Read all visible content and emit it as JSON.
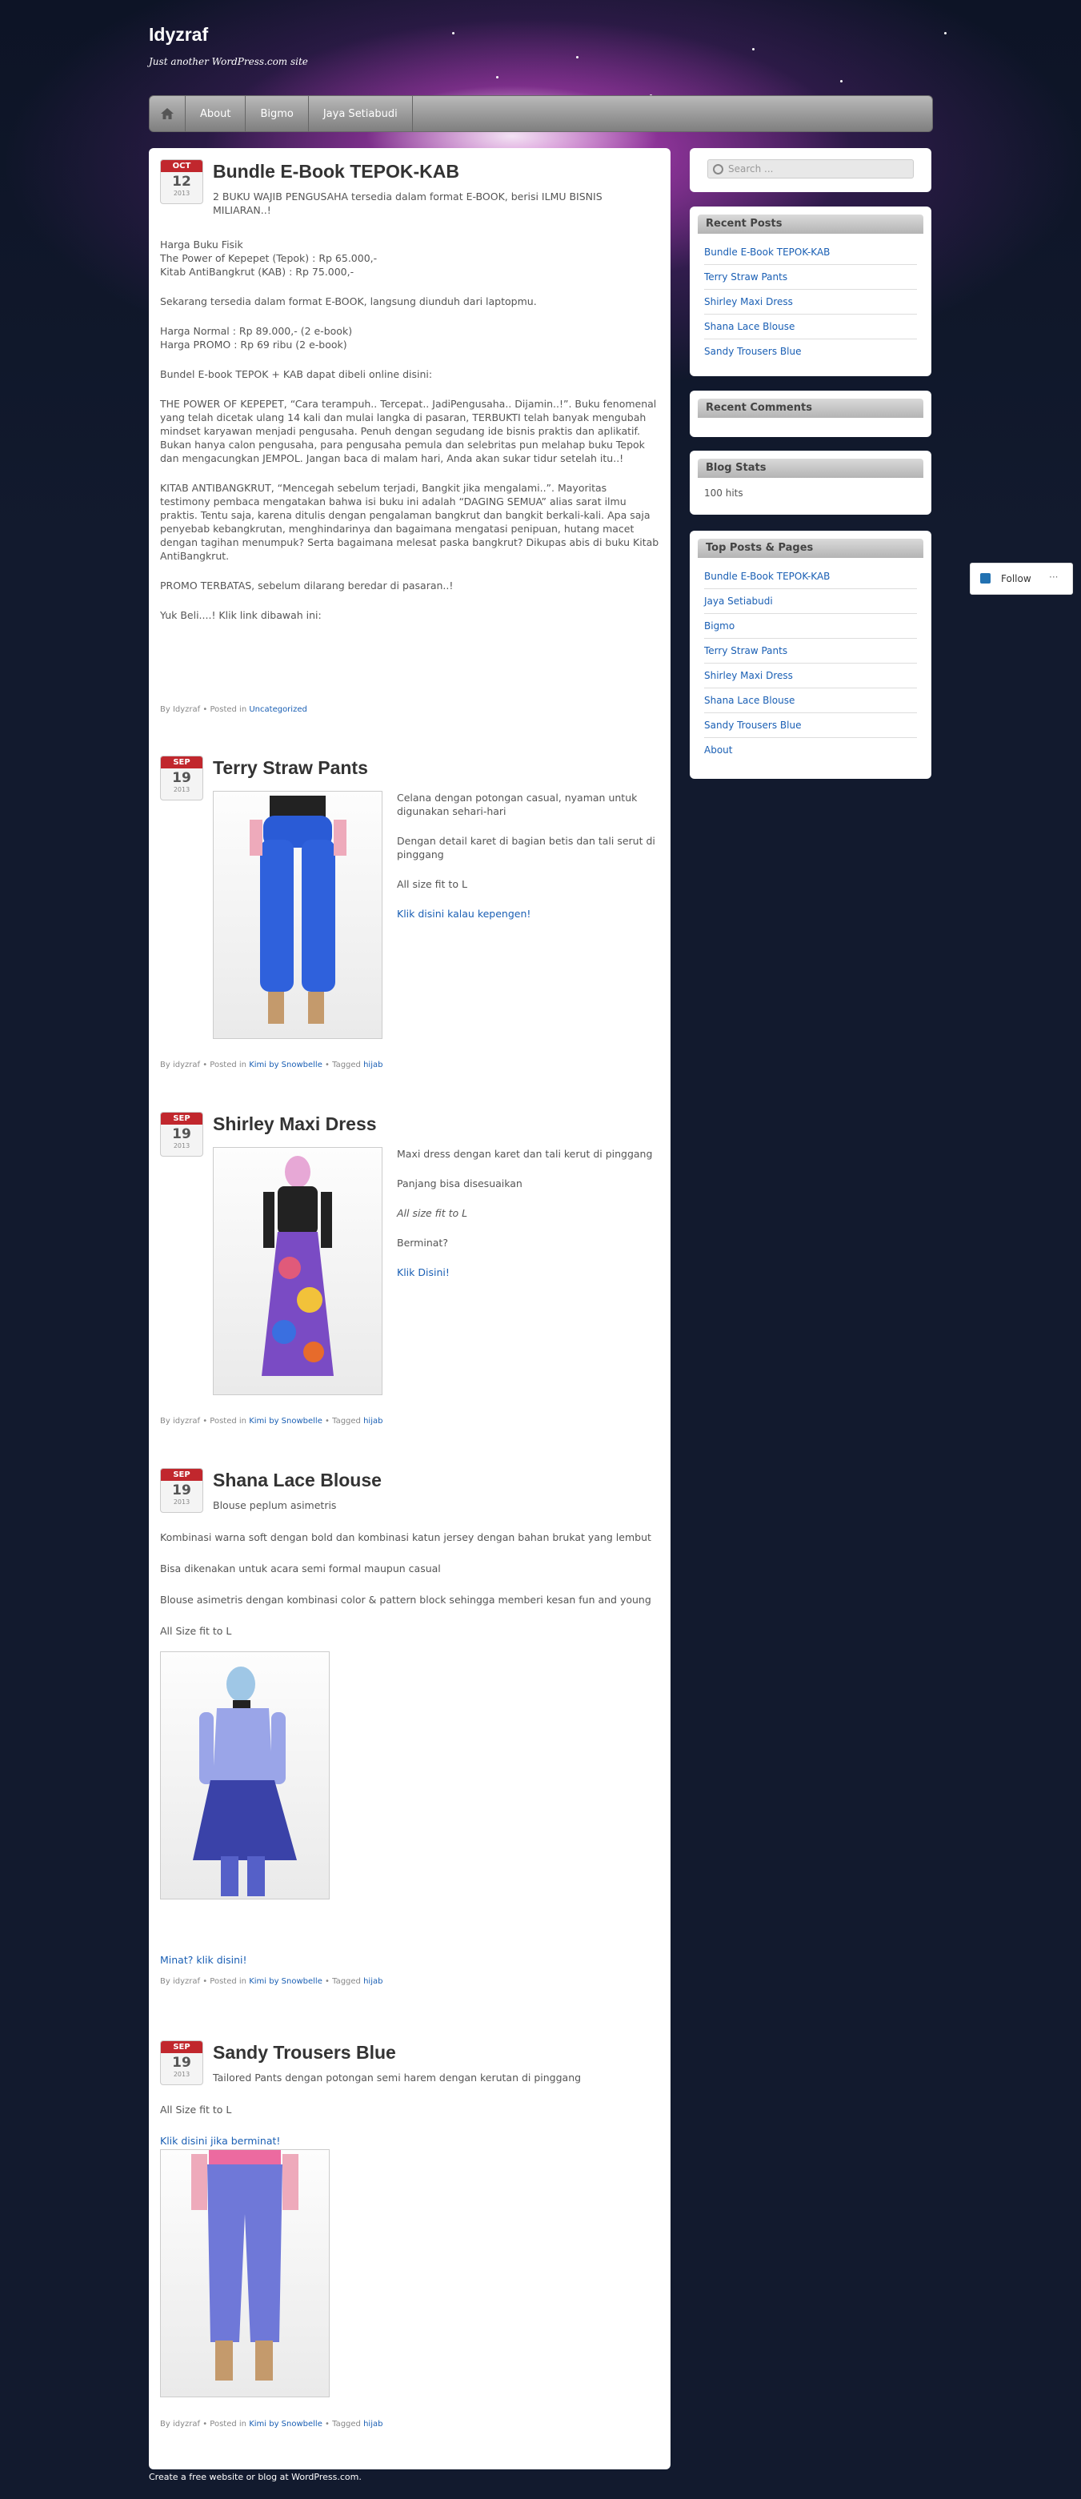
{
  "site": {
    "title": "Idyzraf",
    "description": "Just another WordPress.com site"
  },
  "nav": {
    "items": [
      "About",
      "Bigmo",
      "Jaya Setiabudi"
    ]
  },
  "posts": [
    {
      "month": "OCT",
      "day": "12",
      "year": "2013",
      "title": "Bundle E-Book TEPOK-KAB",
      "lead": "2 BUKU WAJIB PENGUSAHA tersedia dalam format E-BOOK, berisi ILMU BISNIS MILIARAN..!",
      "body": [
        "Harga Buku Fisik",
        "The Power of Kepepet (Tepok) : Rp 65.000,-",
        "Kitab AntiBangkrut (KAB) : Rp 75.000,-",
        "Sekarang tersedia dalam format E-BOOK, langsung diunduh dari laptopmu.",
        "Harga Normal : Rp 89.000,- (2 e-book)",
        "Harga PROMO : Rp 69 ribu (2 e-book)",
        "Bundel E-book TEPOK + KAB dapat dibeli online disini:",
        "THE POWER OF KEPEPET, “Cara terampuh.. Tercepat.. JadiPengusaha.. Dijamin..!”. Buku fenomenal yang telah dicetak ulang 14 kali dan mulai langka di pasaran, TERBUKTI telah banyak mengubah mindset karyawan menjadi pengusaha. Penuh dengan segudang ide bisnis praktis dan aplikatif. Bukan hanya calon pengusaha, para pengusaha pemula dan selebritas pun melahap buku Tepok dan mengacungkan JEMPOL. Jangan baca di malam hari, Anda akan sukar tidur setelah itu..!",
        "KITAB ANTIBANGKRUT, “Mencegah sebelum terjadi, Bangkit jika mengalami..”. Mayoritas testimony pembaca mengatakan bahwa isi buku ini adalah “DAGING SEMUA” alias sarat ilmu praktis. Tentu saja, karena ditulis dengan pengalaman bangkrut dan bangkit berkali-kali. Apa saja penyebab kebangkrutan, menghindarinya dan bagaimana mengatasi penipuan, hutang macet dengan tagihan menumpuk? Serta bagaimana melesat paska bangkrut? Dikupas abis di buku Kitab AntiBangkrut.",
        "PROMO TERBATAS, sebelum dilarang beredar di pasaran..!",
        "Yuk Beli....! Klik link dibawah ini:"
      ],
      "meta": {
        "by": "By Idyzraf",
        "posted": "Posted in",
        "cat": "Uncategorized"
      }
    },
    {
      "month": "SEP",
      "day": "19",
      "year": "2013",
      "title": "Terry Straw Pants",
      "lines": [
        "Celana dengan potongan casual, nyaman untuk digunakan sehari-hari",
        "Dengan detail karet di bagian betis dan tali serut di pinggang",
        "All size fit to L"
      ],
      "link": "Klik disini kalau kepengen!",
      "meta": {
        "by": "By idyzraf",
        "posted": "Posted in",
        "cat": "Kimi by Snowbelle",
        "tagged": "Tagged",
        "tag": "hijab"
      }
    },
    {
      "month": "SEP",
      "day": "19",
      "year": "2013",
      "title": "Shirley Maxi Dress",
      "lines": [
        "Maxi dress dengan karet dan tali kerut di pinggang",
        "Panjang bisa disesuaikan",
        "All size fit to L",
        "Berminat?"
      ],
      "link": "Klik Disini!",
      "meta": {
        "by": "By idyzraf",
        "posted": "Posted in",
        "cat": "Kimi by Snowbelle",
        "tagged": "Tagged",
        "tag": "hijab"
      }
    },
    {
      "month": "SEP",
      "day": "19",
      "year": "2013",
      "title": "Shana Lace Blouse",
      "lines": [
        "Blouse peplum asimetris",
        "Kombinasi warna soft dengan bold dan kombinasi katun jersey dengan bahan brukat yang lembut",
        "Bisa dikenakan untuk acara semi formal maupun casual",
        "Blouse asimetris dengan kombinasi color & pattern block sehingga memberi kesan fun and young",
        "All Size fit to L"
      ],
      "link": "Minat? klik disini!",
      "meta": {
        "by": "By idyzraf",
        "posted": "Posted in",
        "cat": "Kimi by Snowbelle",
        "tagged": "Tagged",
        "tag": "hijab"
      }
    },
    {
      "month": "SEP",
      "day": "19",
      "year": "2013",
      "title": "Sandy Trousers Blue",
      "lines": [
        "Tailored Pants dengan potongan semi harem dengan kerutan di pinggang",
        "All Size fit to L"
      ],
      "link": "Klik disini jika berminat!",
      "meta": {
        "by": "By idyzraf",
        "posted": "Posted in",
        "cat": "Kimi by Snowbelle",
        "tagged": "Tagged",
        "tag": "hijab"
      }
    }
  ],
  "sidebar": {
    "search_placeholder": "Search ...",
    "recent_posts_title": "Recent Posts",
    "recent_posts": [
      "Bundle E-Book TEPOK-KAB",
      "Terry Straw Pants",
      "Shirley Maxi Dress",
      "Shana Lace Blouse",
      "Sandy Trousers Blue"
    ],
    "recent_comments_title": "Recent Comments",
    "blog_stats_title": "Blog Stats",
    "blog_stats_value": "100 hits",
    "top_title": "Top Posts & Pages",
    "top_posts": [
      "Bundle E-Book TEPOK-KAB",
      "Jaya Setiabudi",
      "Bigmo",
      "Terry Straw Pants",
      "Shirley Maxi Dress",
      "Shana Lace Blouse",
      "Sandy Trousers Blue",
      "About"
    ]
  },
  "follow": {
    "label": "Follow",
    "more": "···"
  },
  "footer": "Create a free website or blog at WordPress.com.",
  "colors": {
    "accent": "#1a5fb4",
    "date_badge": "#c1272d"
  }
}
